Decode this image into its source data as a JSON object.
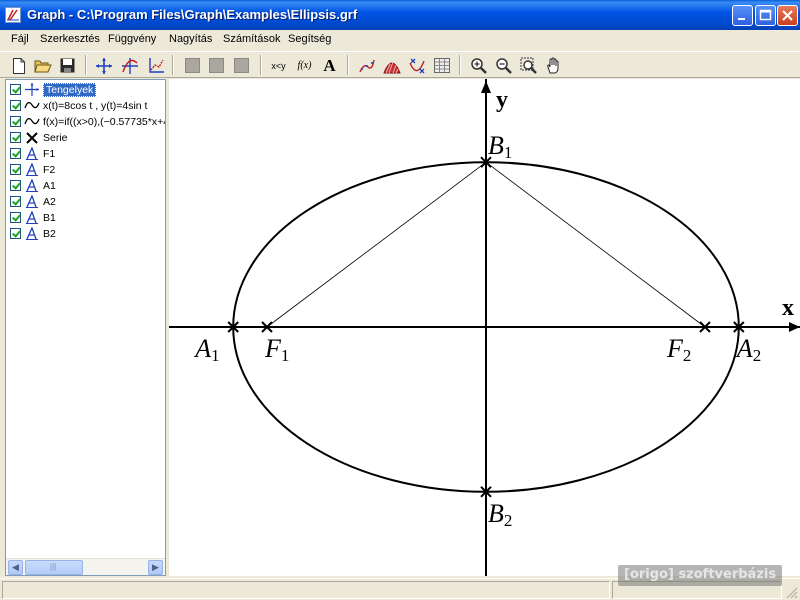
{
  "window": {
    "title": "Graph - C:\\Program Files\\Graph\\Examples\\Ellipsis.grf",
    "controls": {
      "minimize": "_",
      "maximize": "□",
      "close": "✕"
    }
  },
  "menu": [
    {
      "label": "Fájl"
    },
    {
      "label": "Szerkesztés"
    },
    {
      "label": "Függvény"
    },
    {
      "label": "Nagyítás"
    },
    {
      "label": "Számítások"
    },
    {
      "label": "Segítség"
    }
  ],
  "toolbar": {
    "items": [
      "new-icon",
      "open-icon",
      "save-icon",
      "axes-icon",
      "insert-function-icon",
      "insert-tangent-icon",
      "disabled-1",
      "disabled-2",
      "disabled-3",
      "evaluate-icon",
      "fx-icon",
      "insert-label-icon",
      "trendline-icon",
      "shading-icon",
      "point-series-icon",
      "table-icon",
      "zoom-in-icon",
      "zoom-out-icon",
      "zoom-window-icon",
      "pan-hand-icon"
    ],
    "xy_label": "x<y",
    "fx_label": "f(x)",
    "label_A": "A"
  },
  "tree": {
    "items": [
      {
        "label": "Tengelyek",
        "icon": "axes-icon",
        "checked": true,
        "selected": true
      },
      {
        "label": "x(t)=8cos t , y(t)=4sin t",
        "icon": "function-wave-icon",
        "checked": true
      },
      {
        "label": "f(x)=if((x>0),(−0.57735*x+4",
        "icon": "function-wave-icon",
        "checked": true
      },
      {
        "label": "Serie",
        "icon": "cross-marker-icon",
        "checked": true
      },
      {
        "label": "F1",
        "icon": "label-icon",
        "checked": true
      },
      {
        "label": "F2",
        "icon": "label-icon",
        "checked": true
      },
      {
        "label": "A1",
        "icon": "label-icon",
        "checked": true
      },
      {
        "label": "A2",
        "icon": "label-icon",
        "checked": true
      },
      {
        "label": "B1",
        "icon": "label-icon",
        "checked": true
      },
      {
        "label": "B2",
        "icon": "label-icon",
        "checked": true
      }
    ],
    "scroll_left": "◀",
    "scroll_right": "▶",
    "scroll_grip": "|||"
  },
  "graph": {
    "axis_x_label": "x",
    "axis_y_label": "y",
    "ellipse": {
      "a": 8,
      "b": 4
    },
    "foci_c": 6.93,
    "points": [
      {
        "name": "A",
        "sub": "1",
        "x": -8,
        "y": 0
      },
      {
        "name": "F",
        "sub": "1",
        "x": -6.93,
        "y": 0
      },
      {
        "name": "F",
        "sub": "2",
        "x": 6.93,
        "y": 0
      },
      {
        "name": "A",
        "sub": "2",
        "x": 8,
        "y": 0
      },
      {
        "name": "B",
        "sub": "1",
        "x": 0,
        "y": 4
      },
      {
        "name": "B",
        "sub": "2",
        "x": 0,
        "y": -4
      }
    ],
    "line_color": "#000000"
  },
  "watermark": "[origo] szoftverbázis",
  "colors": {
    "titlebar": "#0055e5",
    "selection": "#316ac5",
    "checkmark": "#21a121"
  }
}
